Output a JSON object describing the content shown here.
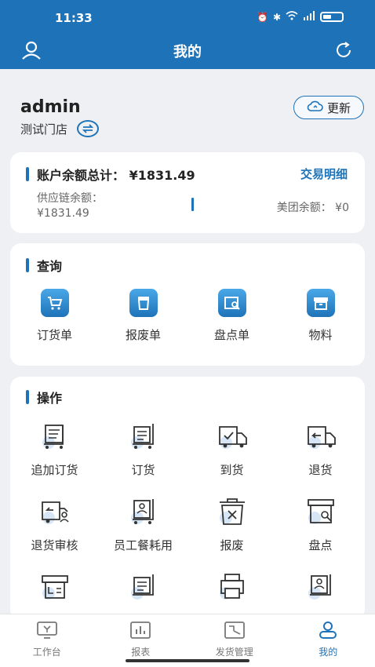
{
  "status": {
    "time": "11:33"
  },
  "nav": {
    "title": "我的"
  },
  "user": {
    "name": "admin",
    "store": "测试门店",
    "update_label": "更新"
  },
  "balance": {
    "title": "账户余额总计：",
    "total": "¥1831.49",
    "detail_link": "交易明细",
    "supply_label": "供应链余额：",
    "supply_value": "¥1831.49",
    "meituan_label": "美团余额：",
    "meituan_value": "¥0"
  },
  "query": {
    "title": "查询",
    "items": [
      {
        "label": "订货单",
        "icon": "cart-icon"
      },
      {
        "label": "报废单",
        "icon": "trash-bin-icon"
      },
      {
        "label": "盘点单",
        "icon": "inventory-check-icon"
      },
      {
        "label": "物料",
        "icon": "box-icon"
      }
    ]
  },
  "ops": {
    "title": "操作",
    "items": [
      {
        "label": "追加订货",
        "icon": "add-order-cart-icon"
      },
      {
        "label": "订货",
        "icon": "order-cart-icon"
      },
      {
        "label": "到货",
        "icon": "delivery-truck-check-icon"
      },
      {
        "label": "退货",
        "icon": "return-truck-icon"
      },
      {
        "label": "退货审核",
        "icon": "return-review-truck-icon"
      },
      {
        "label": "员工餐耗用",
        "icon": "staff-meal-cart-icon"
      },
      {
        "label": "报废",
        "icon": "discard-bin-icon"
      },
      {
        "label": "盘点",
        "icon": "inventory-search-icon"
      },
      {
        "label": "",
        "icon": "printer-list-icon"
      },
      {
        "label": "",
        "icon": "list-cart-icon"
      },
      {
        "label": "",
        "icon": "printer-icon"
      },
      {
        "label": "",
        "icon": "image-cart-icon"
      }
    ]
  },
  "tabs": [
    {
      "label": "工作台",
      "icon": "workbench-icon"
    },
    {
      "label": "报表",
      "icon": "report-chart-icon"
    },
    {
      "label": "发货管理",
      "icon": "shipping-icon"
    },
    {
      "label": "我的",
      "icon": "profile-icon"
    }
  ],
  "colors": {
    "primary": "#1e73b8",
    "background": "#eef0f3"
  }
}
